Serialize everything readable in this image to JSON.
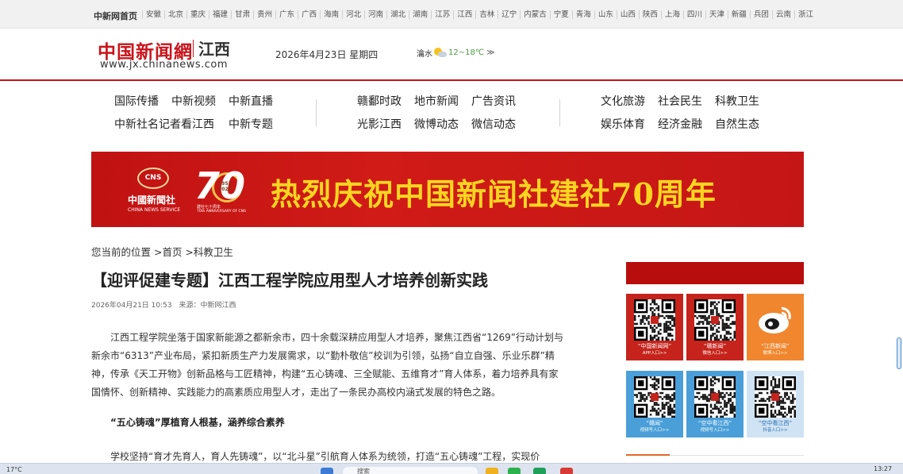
{
  "topbar": {
    "home": "中新网首页",
    "regions": [
      "安徽",
      "北京",
      "重庆",
      "福建",
      "甘肃",
      "贵州",
      "广东",
      "广西",
      "海南",
      "河北",
      "河南",
      "湖北",
      "湖南",
      "江苏",
      "江西",
      "吉林",
      "辽宁",
      "内蒙古",
      "宁夏",
      "青海",
      "山东",
      "山西",
      "陕西",
      "上海",
      "四川",
      "天津",
      "新疆",
      "兵团",
      "云南",
      "浙江"
    ]
  },
  "header": {
    "logo_cn": "中国新闻網",
    "logo_region": "江西",
    "logo_url": "www.jx.chinanews.com",
    "date": "2026年4月23日 星期四",
    "weather_city": "瀹水",
    "weather_low": "12",
    "weather_high": "18℃",
    "weather_more": "≫",
    "weather_icon": "partly-cloudy-icon"
  },
  "nav": {
    "group1": [
      "国际传播",
      "中新视频",
      "中新直播",
      "中新社名记者看江西",
      "",
      "中新专题"
    ],
    "group2": [
      "赣鄱时政",
      "地市新闻",
      "广告资讯",
      "光影江西",
      "微博动态",
      "微信动态"
    ],
    "group3": [
      "文化旅游",
      "社会民生",
      "科教卫生",
      "娱乐体育",
      "经济金融",
      "自然生态"
    ]
  },
  "banner": {
    "cns_mark": "CNS",
    "cns_cn": "中國新聞社",
    "cns_en": "CHINA NEWS SERVICE",
    "seventy": "70",
    "years": "1952\n2022",
    "anniv_cn": "建社七十周年",
    "anniv_en": "70th ANNIVERSARY OF CNS",
    "headline": "热烈庆祝中国新闻社建社70周年"
  },
  "breadcrumb": "您当前的位置 >首页 >科教卫生",
  "article": {
    "title": "【迎评促建专题】江西工程学院应用型人才培养创新实践",
    "date": "2026年04月21日 10:53",
    "source": "来源：中新网江西",
    "p1": "江西工程学院坐落于国家新能源之都新余市，四十余载深耕应用型人才培养，聚焦江西省“1269”行动计划与新余市“6313”产业布局，紧扣新质生产力发展需求，以“勤朴敬信”校训为引领，弘扬“自立自强、乐业乐群”精神，传承《天工开物》创新品格与工匠精神，构建“五心铸魂、三全赋能、五维育才”育人体系，着力培养具有家国情怀、创新精神、实践能力的高素质应用型人才，走出了一条民办高校内涵式发展的特色之路。",
    "subhead": "“五心铸魂”厚植育人根基，涵养综合素养",
    "p2": "学校坚持“育才先育人，育人先铸魂”，以“北斗星”引航育人体系为统领，打造“五心铸魂”工程，实现价"
  },
  "sidebar": {
    "cards": [
      {
        "cap1": "“中国新闻网”",
        "cap2": "APP入口>>",
        "style": "red",
        "icon": "qr-code-icon"
      },
      {
        "cap1": "“赣新闻”",
        "cap2": "微信入口>>",
        "style": "red",
        "icon": "qr-code-icon"
      },
      {
        "cap1": "“江西新闻”",
        "cap2": "微博入口>>",
        "style": "orange",
        "icon": "weibo-icon"
      },
      {
        "cap1": "“赣闻”",
        "cap2": "视频号入口>>",
        "style": "blue",
        "icon": "qr-code-icon"
      },
      {
        "cap1": "“空中看江西”",
        "cap2": "视频号入口>>",
        "style": "blue",
        "icon": "qr-code-icon"
      },
      {
        "cap1": "“空中看江西”",
        "cap2": "抖音入口>>",
        "style": "light",
        "icon": "qr-code-icon"
      }
    ]
  },
  "taskbar": {
    "weather": "17°C",
    "search": "搜索",
    "clock": "13:27"
  },
  "colors": {
    "brand_red": "#c8141b",
    "banner_yellow": "#ffd61f"
  }
}
